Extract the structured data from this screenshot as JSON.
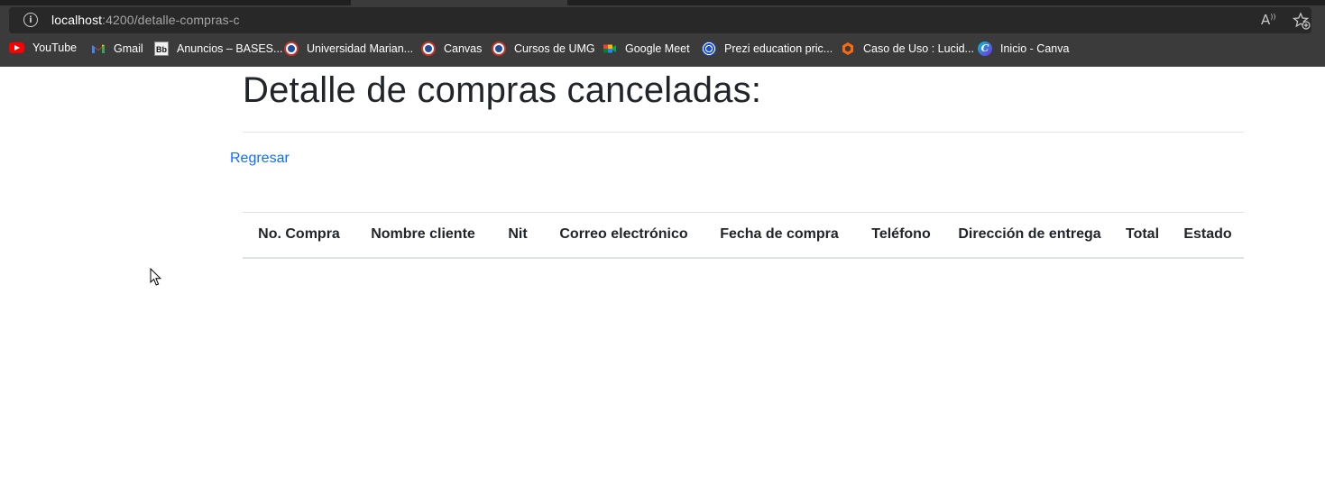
{
  "browser": {
    "url_host": "localhost",
    "url_path": ":4200/detalle-compras-c",
    "read_aloud_label": "A",
    "bookmarks": [
      {
        "label": "YouTube",
        "icon": "youtube-icon"
      },
      {
        "label": "Gmail",
        "icon": "gmail-icon"
      },
      {
        "label": "Anuncios – BASES...",
        "icon": "blackboard-icon",
        "icon_text": "Bb"
      },
      {
        "label": "Universidad Marian...",
        "icon": "umg-icon"
      },
      {
        "label": "Canvas",
        "icon": "umg-icon"
      },
      {
        "label": "Cursos de UMG",
        "icon": "umg-icon"
      },
      {
        "label": "Google Meet",
        "icon": "google-meet-icon"
      },
      {
        "label": "Prezi education pric...",
        "icon": "prezi-icon"
      },
      {
        "label": "Caso de Uso : Lucid...",
        "icon": "lucid-icon"
      },
      {
        "label": "Inicio - Canva",
        "icon": "canva-icon",
        "icon_text": "C"
      }
    ]
  },
  "page": {
    "title": "Detalle de compras canceladas:",
    "back_link": "Regresar"
  },
  "table": {
    "headers": [
      "No. Compra",
      "Nombre cliente",
      "Nit",
      "Correo electrónico",
      "Fecha de compra",
      "Teléfono",
      "Dirección de entrega",
      "Total",
      "Estado"
    ],
    "rows": []
  },
  "colors": {
    "link": "#0d6efd",
    "text": "#212529",
    "chrome_bg": "#3b3b3b",
    "addressbar_bg": "#282828"
  }
}
